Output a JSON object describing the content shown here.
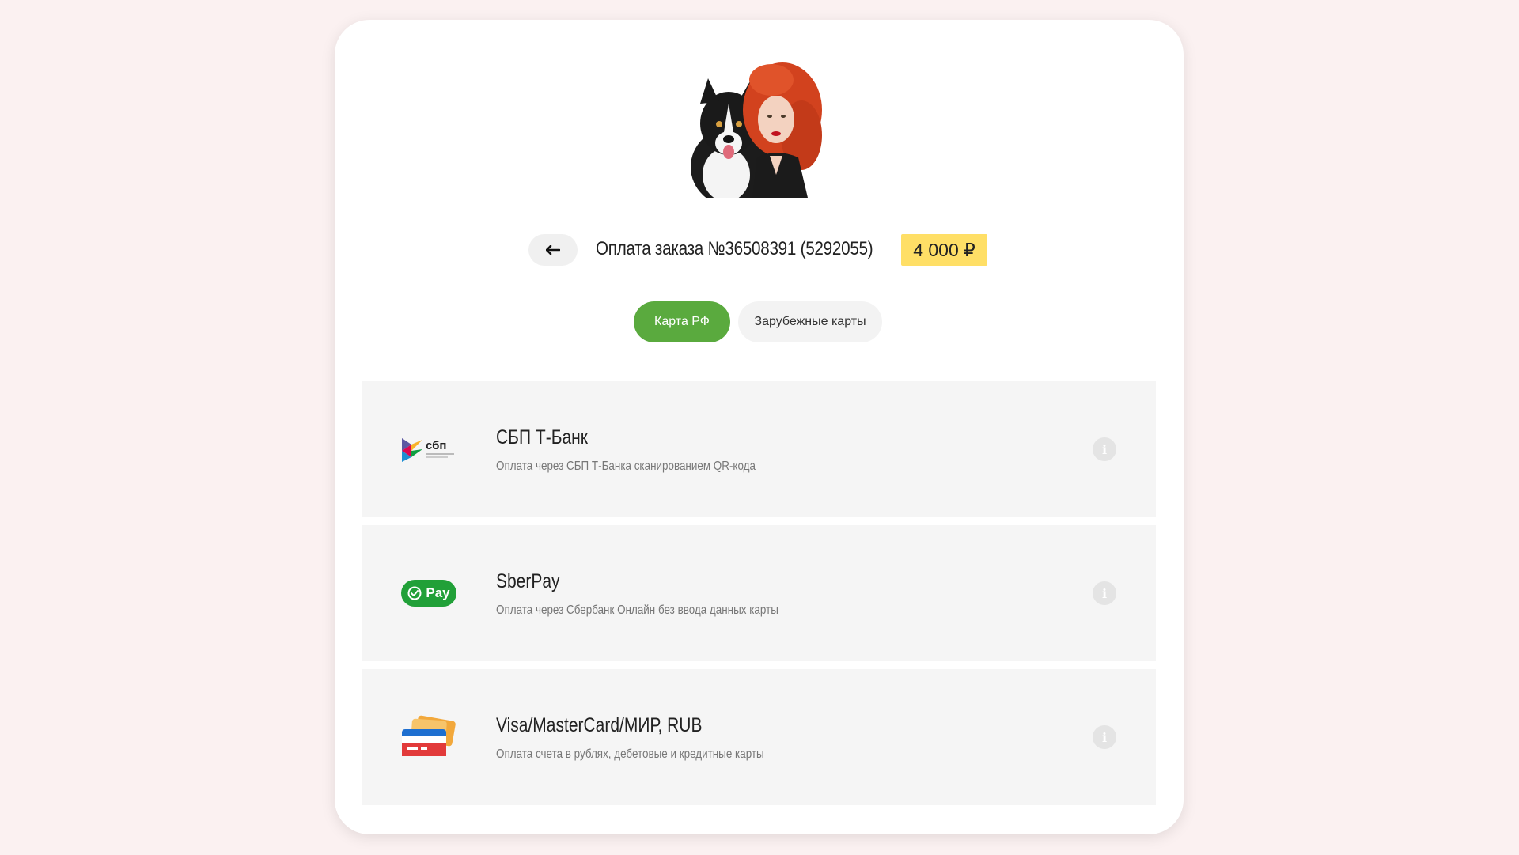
{
  "order": {
    "title": "Оплата заказа №36508391 (5292055)",
    "amount": "4 000 ₽"
  },
  "tabs": [
    {
      "label": "Карта РФ",
      "active": true
    },
    {
      "label": "Зарубежные карты",
      "active": false
    }
  ],
  "methods": [
    {
      "name": "СБП Т-Банк",
      "description": "Оплата через СБП Т-Банка сканированием QR-кода",
      "icon": "sbp-logo-icon",
      "logo_text": "сбп"
    },
    {
      "name": "SberPay",
      "description": "Оплата через Сбербанк Онлайн без ввода данных карты",
      "icon": "sberpay-logo-icon",
      "logo_text": "Pay"
    },
    {
      "name": "Visa/MasterCard/МИР, RUB",
      "description": "Оплата счета в рублях, дебетовые и кредитные карты",
      "icon": "bank-cards-icon"
    }
  ],
  "colors": {
    "page_bg": "#fbf1f1",
    "accent_green": "#5aaa3e",
    "amount_yellow": "#ffdf66",
    "sber_green": "#21a038"
  }
}
